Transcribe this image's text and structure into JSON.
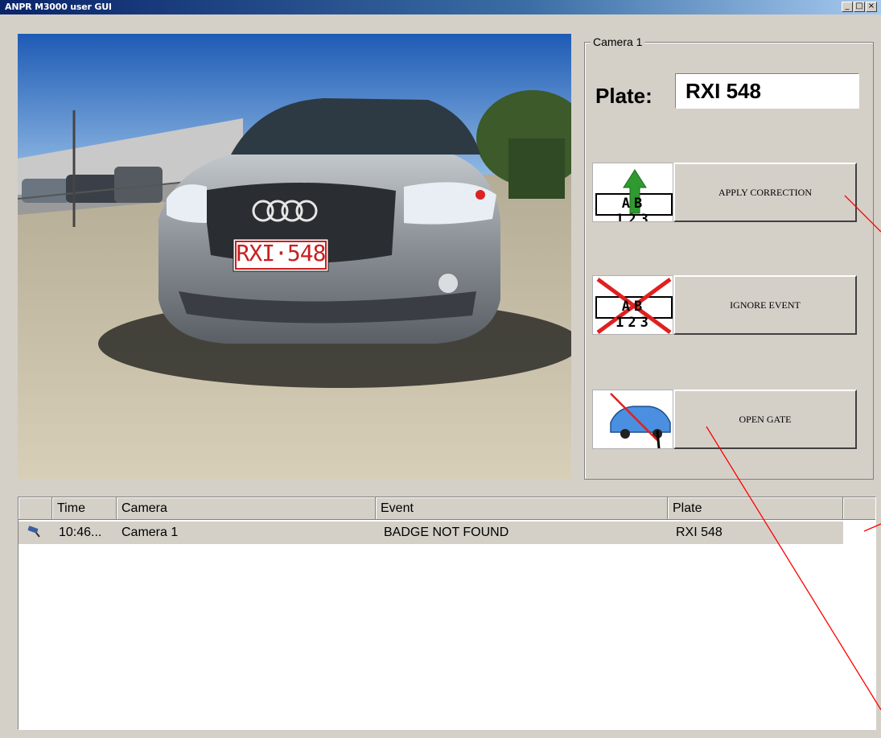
{
  "window": {
    "title": "ANPR M3000 user GUI",
    "controls": [
      "_",
      "□",
      "×"
    ]
  },
  "camera_image": {
    "plate_text": "RXI·548",
    "brand_logo": "audi-rings"
  },
  "camera_group": {
    "title": "Camera 1",
    "plate_label": "Plate:",
    "plate_value": "RXI 548"
  },
  "actions": [
    {
      "label": "APPLY CORRECTION",
      "icon": "plate-correction-icon",
      "plate_text": "AB 123"
    },
    {
      "label": "IGNORE EVENT",
      "icon": "plate-ignore-icon",
      "plate_text": "AB 123"
    },
    {
      "label": "OPEN GATE",
      "icon": "gate-car-icon"
    }
  ],
  "event_list": {
    "columns": [
      "Time",
      "Camera",
      "Event",
      "Plate"
    ],
    "rows": [
      {
        "icon": "camera-icon",
        "time": "10:46...",
        "camera": "Camera 1",
        "event": "BADGE NOT FOUND",
        "plate": "RXI 548"
      }
    ]
  },
  "colors": {
    "titlebar": "#0a246a",
    "window_face": "#d4d0c8",
    "annotation_line": "#ff0000"
  }
}
